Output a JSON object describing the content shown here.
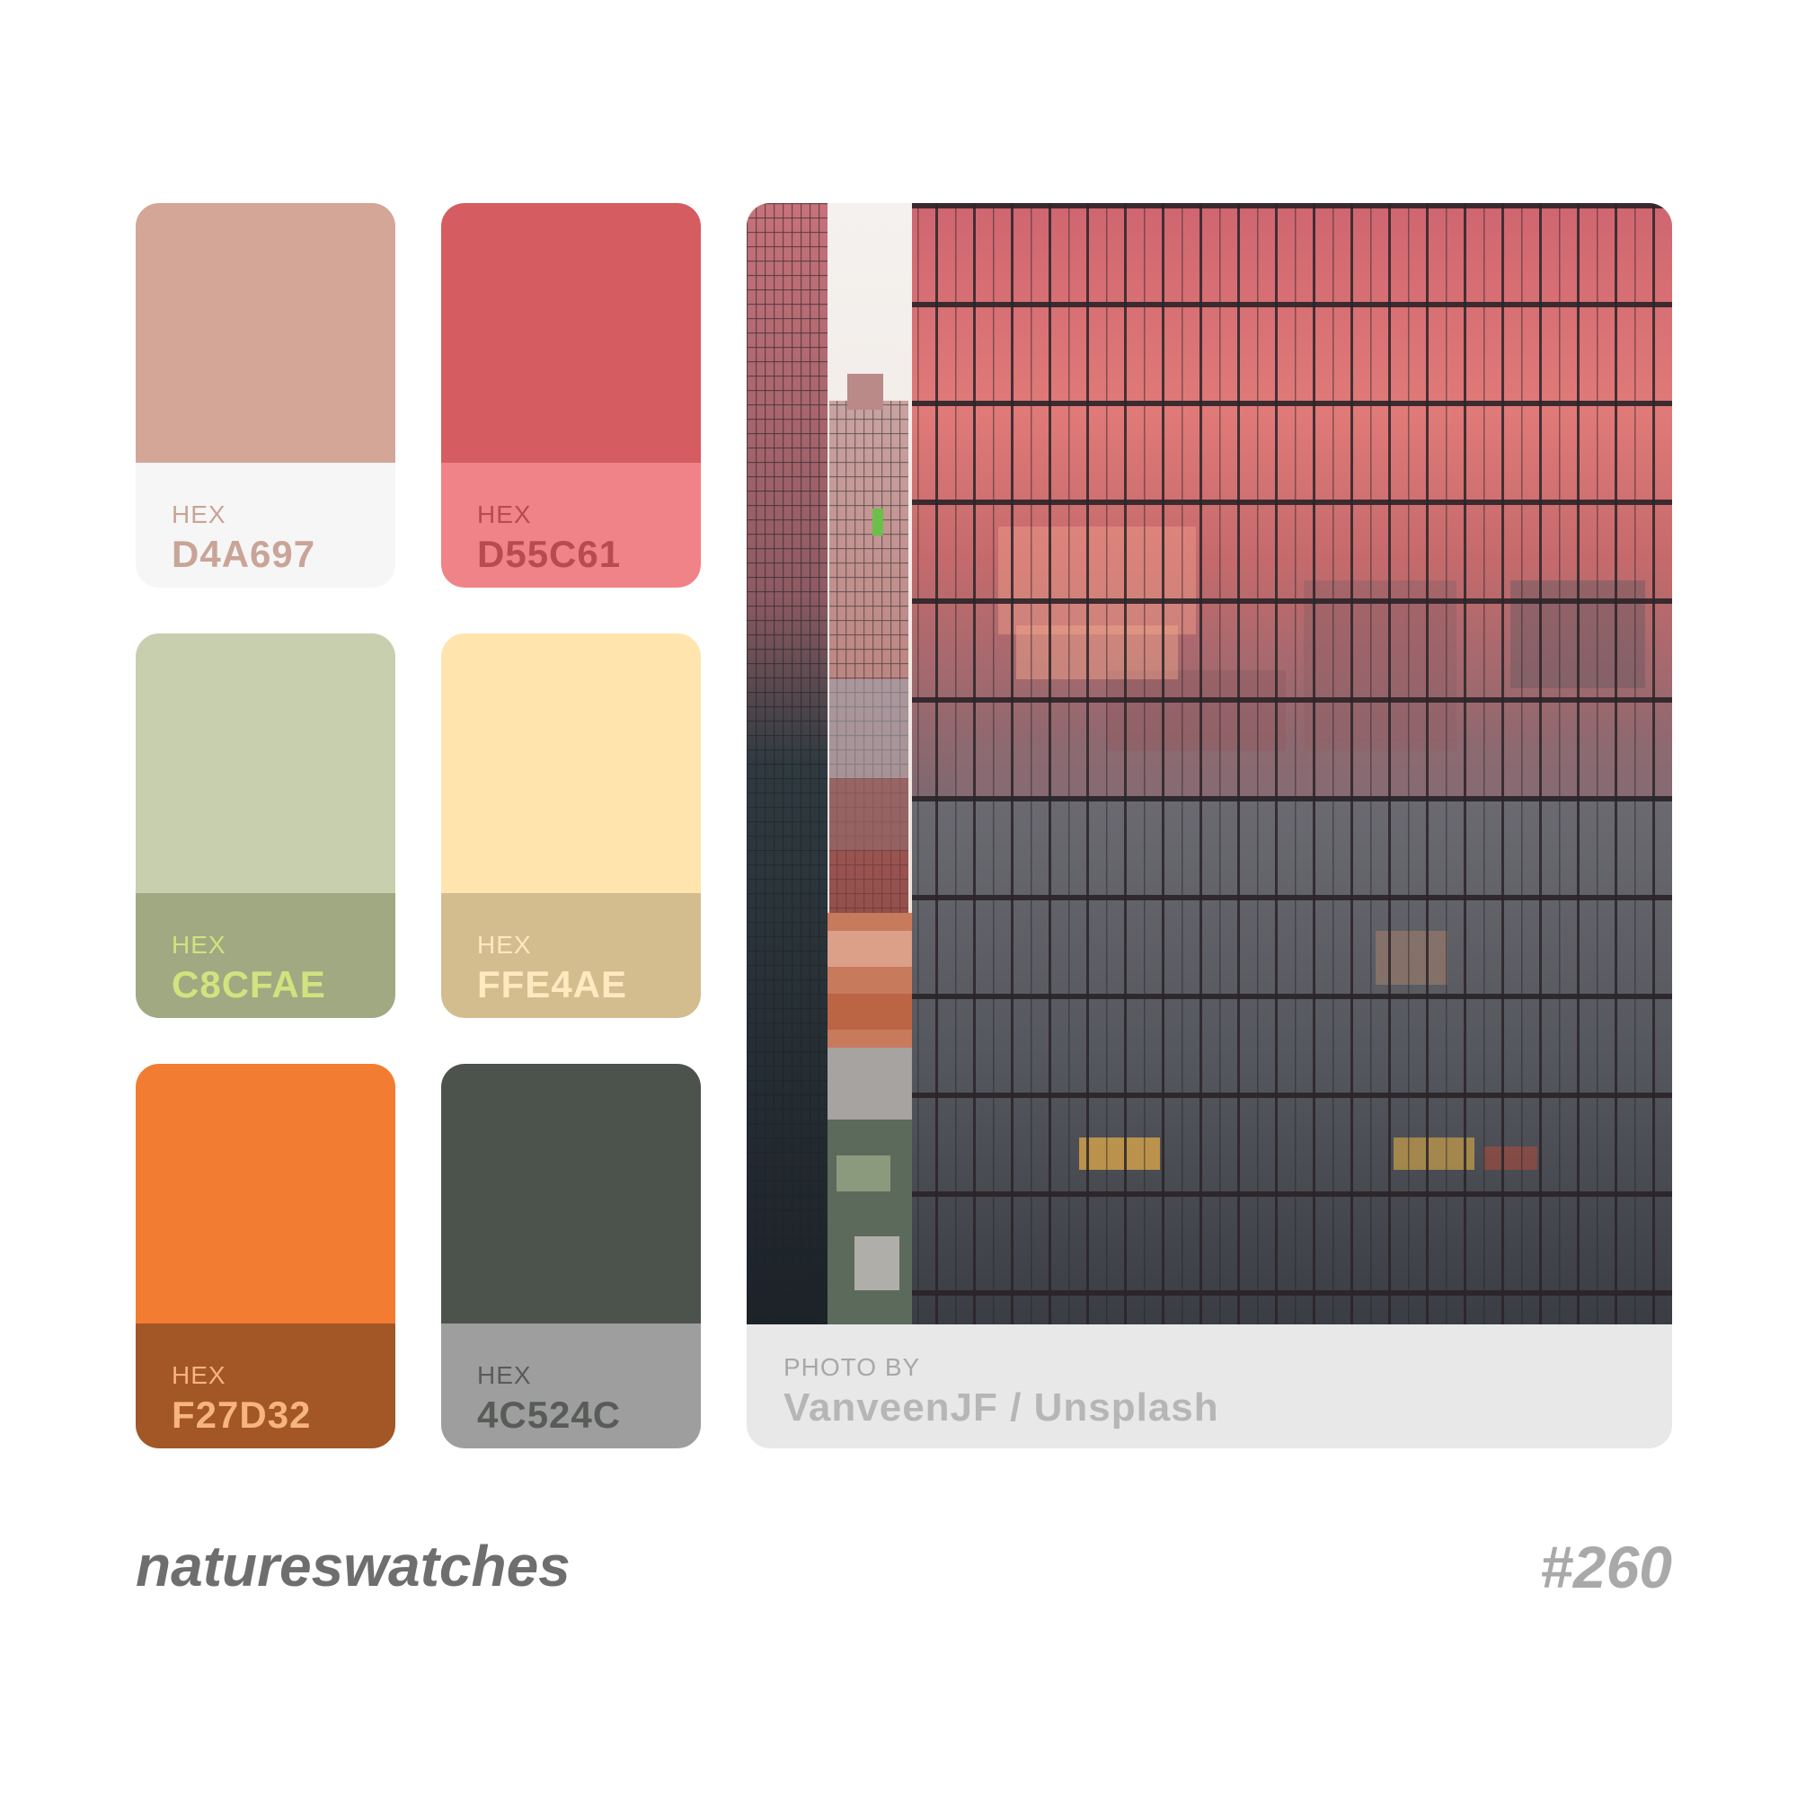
{
  "swatches": [
    {
      "label": "HEX",
      "hex": "D4A697",
      "color": "#D4A697",
      "info_bg": "#F6F6F6",
      "label_color": "#C9A497",
      "hex_color": "#C9A497"
    },
    {
      "label": "HEX",
      "hex": "D55C61",
      "color": "#D55C61",
      "info_bg": "#F08387",
      "label_color": "#B84A50",
      "hex_color": "#B84A50"
    },
    {
      "label": "HEX",
      "hex": "C8CFAE",
      "color": "#C8CFAE",
      "info_bg": "#A0A981",
      "label_color": "#D2E27F",
      "hex_color": "#D2E27F"
    },
    {
      "label": "HEX",
      "hex": "FFE4AE",
      "color": "#FFE4AE",
      "info_bg": "#D3BD8F",
      "label_color": "#FFE9BF",
      "hex_color": "#FFE9BF"
    },
    {
      "label": "HEX",
      "hex": "F27D32",
      "color": "#F27D32",
      "info_bg": "#A35626",
      "label_color": "#F6B47F",
      "hex_color": "#F6B47F"
    },
    {
      "label": "HEX",
      "hex": "4C524C",
      "color": "#4C524C",
      "info_bg": "#9E9E9E",
      "label_color": "#585C58",
      "hex_color": "#585C58"
    }
  ],
  "photo_credit": {
    "label": "PHOTO BY",
    "name": "VanveenJF / Unsplash"
  },
  "brand": "natureswatches",
  "number": "#260"
}
